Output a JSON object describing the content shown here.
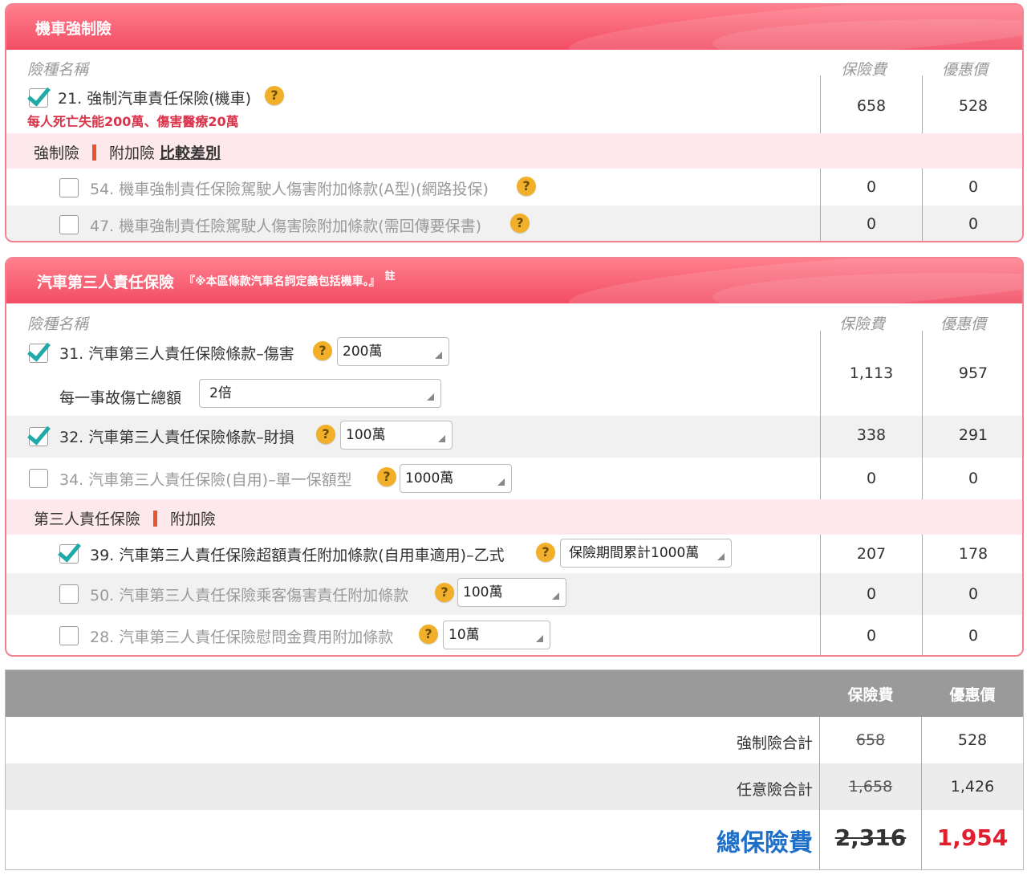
{
  "panel1": {
    "title": "機車強制險",
    "col_name": "險種名稱",
    "col_premium": "保險費",
    "col_discount": "優惠價",
    "item21": {
      "label": "21. 強制汽車責任保險(機車)",
      "note": "每人死亡失能200萬、傷害醫療20萬",
      "premium": "658",
      "discount": "528",
      "checked": true
    },
    "compare": {
      "left": "強制險",
      "right": "附加險",
      "link": "比較差別"
    },
    "item54": {
      "label": "54. 機車強制責任保險駕駛人傷害附加條款(A型)(網路投保)",
      "premium": "0",
      "discount": "0",
      "checked": false
    },
    "item47": {
      "label": "47. 機車強制責任險駕駛人傷害險附加條款(需回傳要保書)",
      "premium": "0",
      "discount": "0",
      "checked": false
    }
  },
  "panel2": {
    "title": "汽車第三人責任保險",
    "subtitle": "『※本區條款汽車名詞定義包括機車。』",
    "note_mark": "註",
    "col_name": "險種名稱",
    "col_premium": "保險費",
    "col_discount": "優惠價",
    "item31": {
      "label": "31. 汽車第三人責任保險條款–傷害",
      "select": "200萬",
      "sub_label": "每一事故傷亡總額",
      "sub_select": "2倍",
      "premium": "1,113",
      "discount": "957",
      "checked": true
    },
    "item32": {
      "label": "32. 汽車第三人責任保險條款–財損",
      "select": "100萬",
      "premium": "338",
      "discount": "291",
      "checked": true
    },
    "item34": {
      "label": "34. 汽車第三人責任保險(自用)–單一保額型",
      "select": "1000萬",
      "premium": "0",
      "discount": "0",
      "checked": false
    },
    "addon": {
      "left": "第三人責任保險",
      "right": "附加險"
    },
    "item39": {
      "label": "39. 汽車第三人責任保險超額責任附加條款(自用車適用)–乙式",
      "select": "保險期間累計1000萬",
      "premium": "207",
      "discount": "178",
      "checked": true
    },
    "item50": {
      "label": "50. 汽車第三人責任保險乘客傷害責任附加條款",
      "select": "100萬",
      "premium": "0",
      "discount": "0",
      "checked": false
    },
    "item28": {
      "label": "28. 汽車第三人責任保險慰問金費用附加條款",
      "select": "10萬",
      "premium": "0",
      "discount": "0",
      "checked": false
    }
  },
  "totals": {
    "col_premium": "保險費",
    "col_discount": "優惠價",
    "compulsory": {
      "label": "強制險合計",
      "premium": "658",
      "discount": "528"
    },
    "optional": {
      "label": "任意險合計",
      "premium": "1,658",
      "discount": "1,426"
    },
    "grand": {
      "label": "總保險費",
      "premium": "2,316",
      "discount": "1,954"
    }
  },
  "colors": {
    "header_red": "#f24d64",
    "check_teal": "#1daaa8",
    "grand_label_blue": "#1e6fc8",
    "grand_discount_red": "#e0202e"
  },
  "help_icon": "?"
}
